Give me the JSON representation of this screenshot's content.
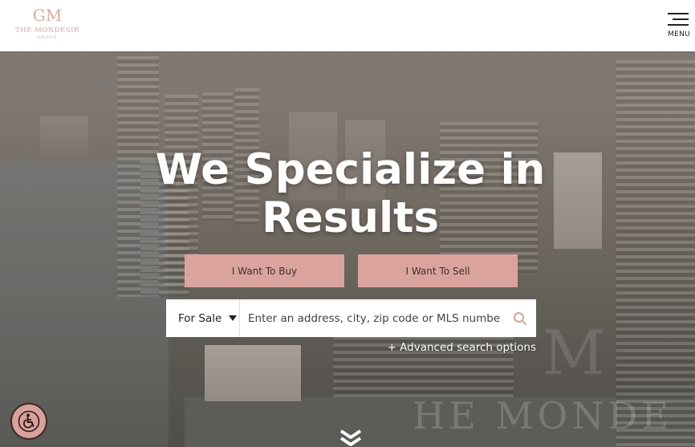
{
  "header": {
    "logo_mark": "GM",
    "logo_text": "THE MONDESIR",
    "logo_sub": "GROUP",
    "menu_label": "MENU"
  },
  "hero": {
    "headline_line1": "We Specialize in",
    "headline_line2": "Results",
    "buy_button": "I Want To Buy",
    "sell_button": "I Want To Sell",
    "watermark_text": "HE MONDE",
    "watermark_logo": "M"
  },
  "search": {
    "mode_selected": "For Sale",
    "placeholder": "Enter an address, city, zip code or MLS numbe",
    "advanced_link": "+ Advanced search options"
  },
  "colors": {
    "accent": "#dba39e",
    "logo": "#d2a49a",
    "header_bg": "#ffffff"
  },
  "icons": {
    "search": "search-icon",
    "menu": "hamburger-icon",
    "accessibility": "accessibility-icon",
    "scroll": "double-chevron-down-icon"
  }
}
